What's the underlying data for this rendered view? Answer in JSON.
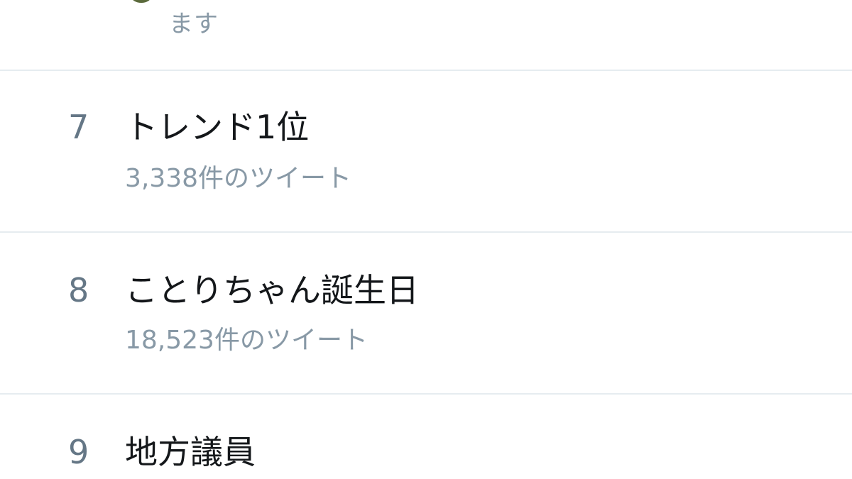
{
  "previous_item": {
    "context_tail": "ます"
  },
  "trends": [
    {
      "rank": "7",
      "topic": "トレンド1位",
      "tweet_count": "3,338件のツイート"
    },
    {
      "rank": "8",
      "topic": "ことりちゃん誕生日",
      "tweet_count": "18,523件のツイート"
    },
    {
      "rank": "9",
      "topic": "地方議員"
    }
  ],
  "colors": {
    "rank": "#657786",
    "topic": "#14171a",
    "meta": "#8899a6",
    "divider": "#e6ecf0",
    "background": "#ffffff"
  }
}
